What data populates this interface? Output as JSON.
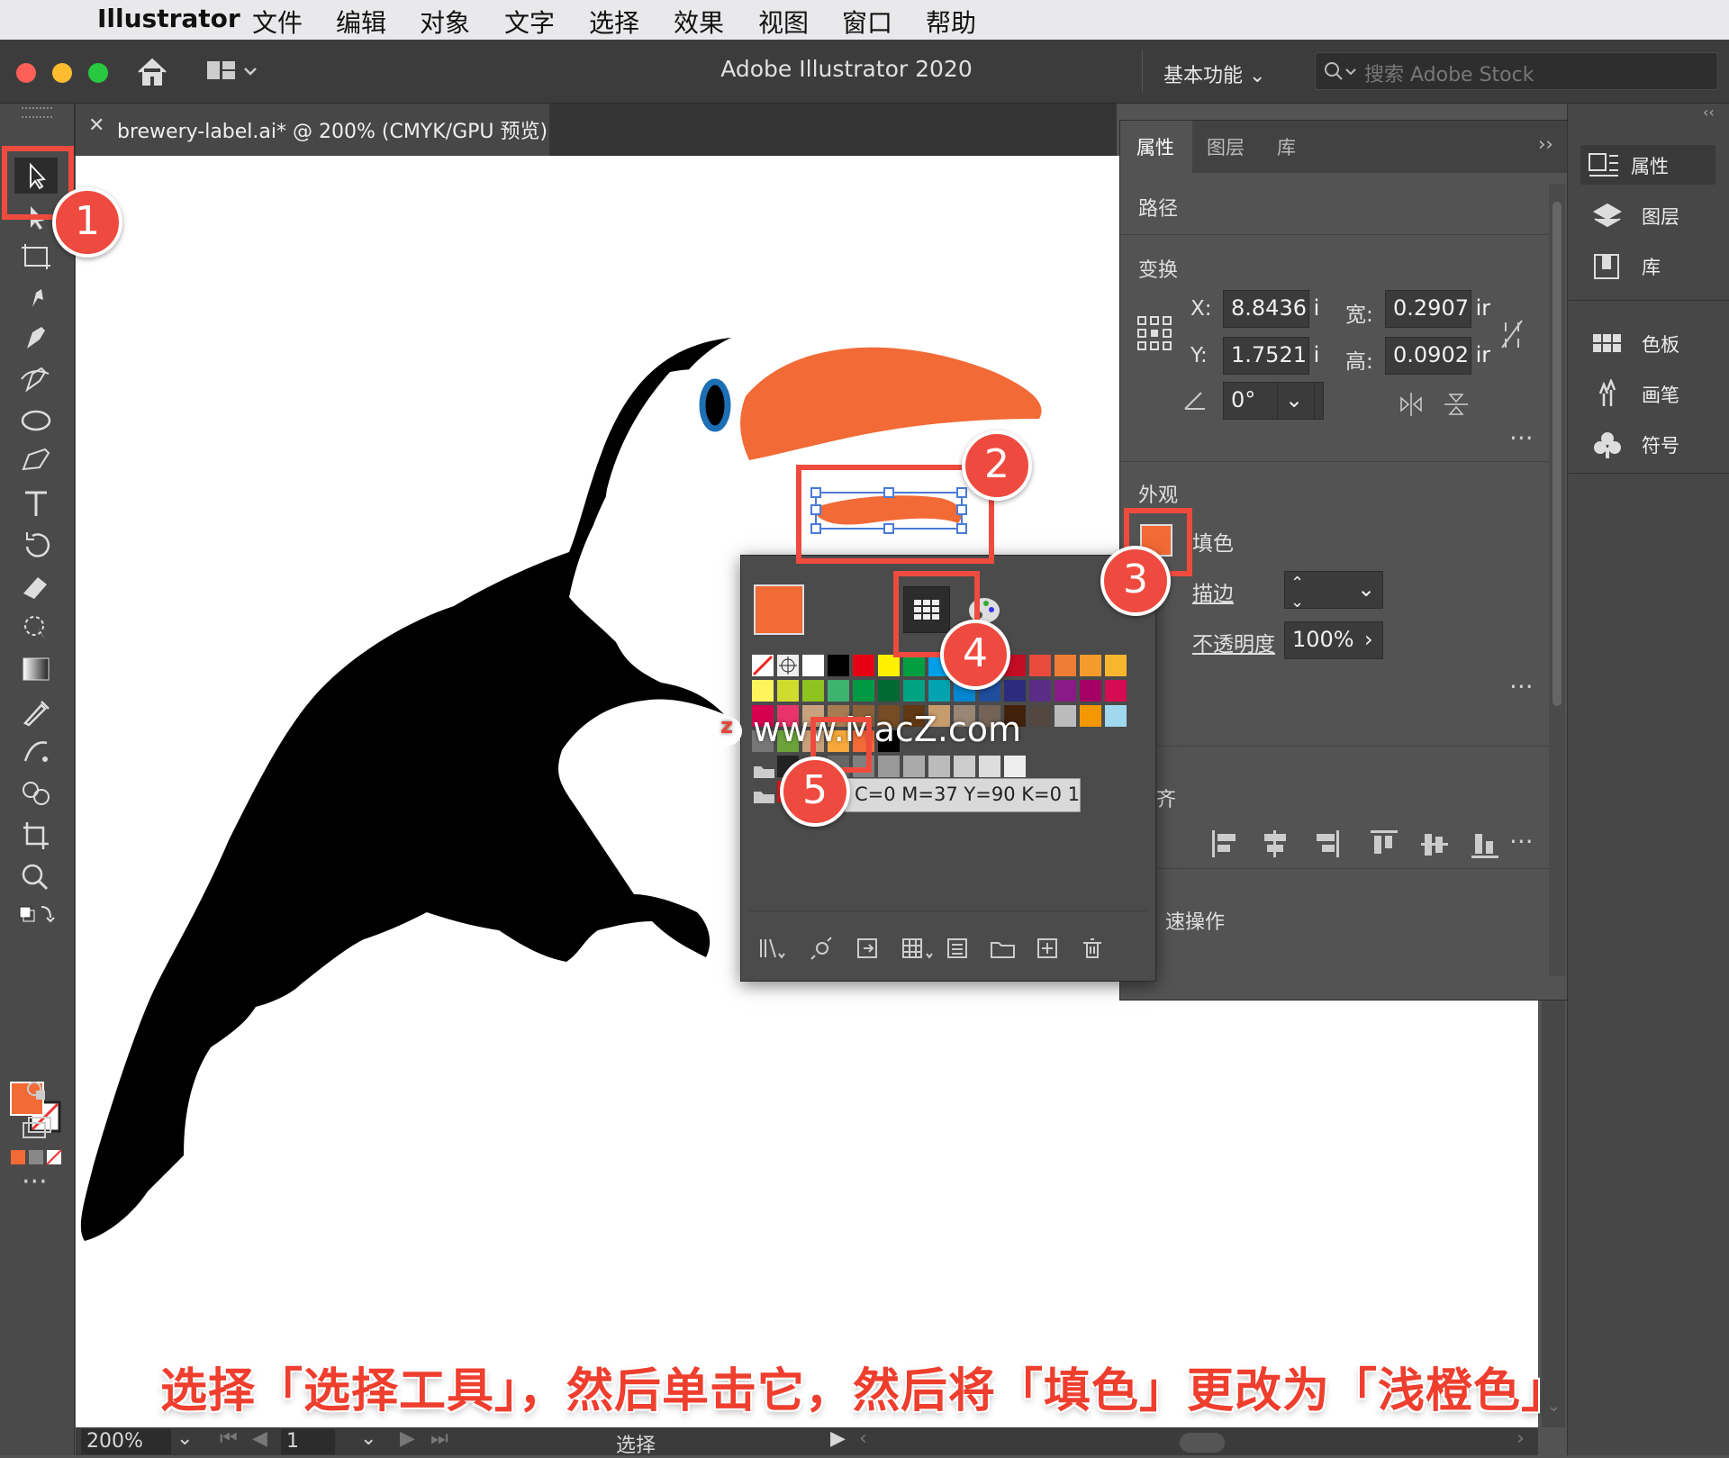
{
  "menubar": {
    "app": "Illustrator",
    "items": [
      "文件",
      "编辑",
      "对象",
      "文字",
      "选择",
      "效果",
      "视图",
      "窗口",
      "帮助"
    ]
  },
  "titlebar": {
    "title": "Adobe Illustrator 2020",
    "workspace": "基本功能",
    "stock_placeholder": "搜索 Adobe Stock"
  },
  "document_tab": {
    "title": "brewery-label.ai* @ 200% (CMYK/GPU 预览)"
  },
  "properties": {
    "tabs": [
      "属性",
      "图层",
      "库"
    ],
    "object_type": "路径",
    "transform": {
      "heading": "变换",
      "x_label": "X:",
      "x": "8.8436 i",
      "y_label": "Y:",
      "y": "1.7521 i",
      "w_label": "宽:",
      "w": "0.2907 ir",
      "h_label": "高:",
      "h": "0.0902 ir",
      "angle": "0°"
    },
    "appearance": {
      "heading": "外观",
      "fill_label": "填色",
      "stroke_label": "描边",
      "opacity_label": "不透明度",
      "opacity": "100%"
    },
    "align_heading_partial": "齐",
    "quick_actions_partial": "速操作"
  },
  "dock": {
    "items": [
      "属性",
      "图层",
      "库",
      "色板",
      "画笔",
      "符号"
    ]
  },
  "swatch_tooltip": "C=0 M=37 Y=90 K=0 1",
  "watermark": "www.MacZ.com",
  "status": {
    "zoom": "200%",
    "artboard": "1",
    "tool": "选择"
  },
  "caption": "选择「选择工具」，然后单击它，然后将「填色」更改为「浅橙色」",
  "callouts": [
    "1",
    "2",
    "3",
    "4",
    "5"
  ],
  "colors": {
    "fill_orange": "#f26a35",
    "toucan_black": "#000000",
    "eye_blue": "#1d6fb5",
    "highlight_red": "#ee4b3e"
  }
}
